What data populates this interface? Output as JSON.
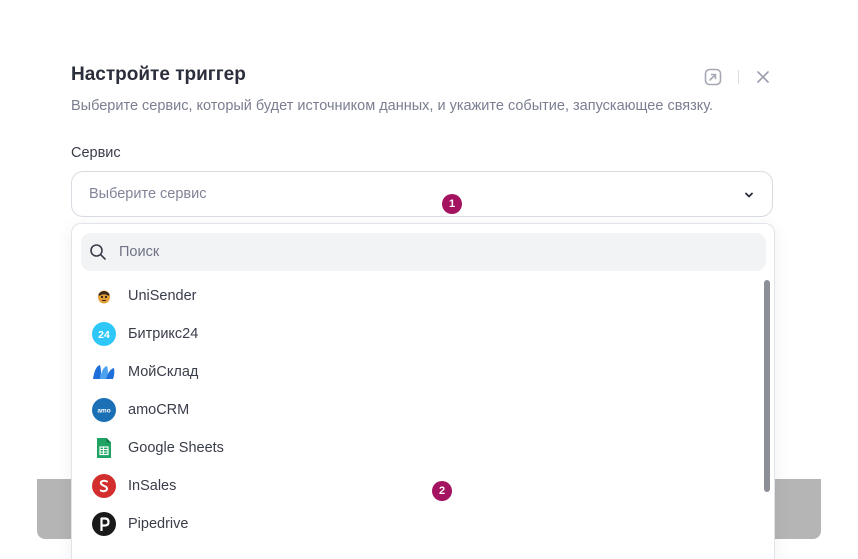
{
  "modal": {
    "title": "Настройте триггер",
    "subtitle": "Выберите сервис, который будет источником данных, и укажите событие, запускающее связку.",
    "header_icons": [
      "open-in-new-icon",
      "close-icon"
    ]
  },
  "service_field": {
    "label": "Сервис",
    "placeholder": "Выберите сервис",
    "chevron_icon": "chevron-down-icon"
  },
  "dropdown": {
    "search_placeholder": "Поиск",
    "search_icon": "search-icon",
    "items": [
      {
        "label": "UniSender",
        "icon": "unisender-logo-icon"
      },
      {
        "label": "Битрикс24",
        "icon": "bitrix24-logo-icon"
      },
      {
        "label": "МойСклад",
        "icon": "moysklad-logo-icon"
      },
      {
        "label": "amoCRM",
        "icon": "amocrm-logo-icon"
      },
      {
        "label": "Google Sheets",
        "icon": "google-sheets-logo-icon"
      },
      {
        "label": "InSales",
        "icon": "insales-logo-icon"
      },
      {
        "label": "Pipedrive",
        "icon": "pipedrive-logo-icon"
      }
    ]
  },
  "markers": [
    "1",
    "2"
  ],
  "colors": {
    "marker": "#a3135f",
    "title": "#2b2e3b",
    "muted_text": "#7a7e90",
    "bitrix": "#2fc7f7",
    "moysklad": "#1e6fd9",
    "amocrm": "#1a6fb5",
    "sheets": "#1fa463",
    "insales": "#d22e2e",
    "pipedrive": "#1a1a1a"
  }
}
